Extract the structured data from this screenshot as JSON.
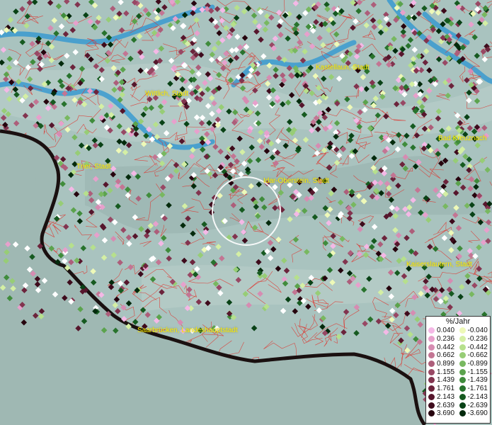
{
  "map": {
    "cities": [
      {
        "name": "Kastellaun, Stadt"
      },
      {
        "name": "Wittlich, Stadt"
      },
      {
        "name": "Bad Kreuznach"
      },
      {
        "name": "Trier, Stadt"
      },
      {
        "name": "Idar-Oberstein, Stadt"
      },
      {
        "name": "Kaiserslautern, Stadt"
      },
      {
        "name": "Saarbrücken, Landeshauptstadt"
      }
    ],
    "colors": {
      "terrain": "#a9c3bf",
      "outside": "#9fb8b3",
      "water": "#3a9bd0",
      "boundary_lines": "#e0312a",
      "state_border": "#1a1010",
      "label": "#ffef00",
      "focus_circle": "#ffffff"
    }
  },
  "legend": {
    "title": "%/Jahr",
    "positive": [
      {
        "label": "0.040",
        "color": "#f4b8e6"
      },
      {
        "label": "0.236",
        "color": "#e7a0cc"
      },
      {
        "label": "0.442",
        "color": "#d68cb2"
      },
      {
        "label": "0.662",
        "color": "#c37593"
      },
      {
        "label": "0.899",
        "color": "#ad5e7a"
      },
      {
        "label": "1.155",
        "color": "#984864"
      },
      {
        "label": "1.439",
        "color": "#82344f"
      },
      {
        "label": "1.761",
        "color": "#6c243c"
      },
      {
        "label": "2.143",
        "color": "#56162c"
      },
      {
        "label": "2.639",
        "color": "#3e0b1c"
      },
      {
        "label": "3.690",
        "color": "#26040e"
      }
    ],
    "negative": [
      {
        "label": "-0.040",
        "color": "#eef9b8"
      },
      {
        "label": "-0.236",
        "color": "#d4efa4"
      },
      {
        "label": "-0.442",
        "color": "#b6e08c"
      },
      {
        "label": "-0.662",
        "color": "#97cd76"
      },
      {
        "label": "-0.899",
        "color": "#78b860"
      },
      {
        "label": "-1.155",
        "color": "#5ba34d"
      },
      {
        "label": "-1.439",
        "color": "#408c3c"
      },
      {
        "label": "-1.761",
        "color": "#28732d"
      },
      {
        "label": "-2.143",
        "color": "#165a20"
      },
      {
        "label": "-2.639",
        "color": "#094216"
      },
      {
        "label": "-3.690",
        "color": "#032a0c"
      }
    ]
  }
}
